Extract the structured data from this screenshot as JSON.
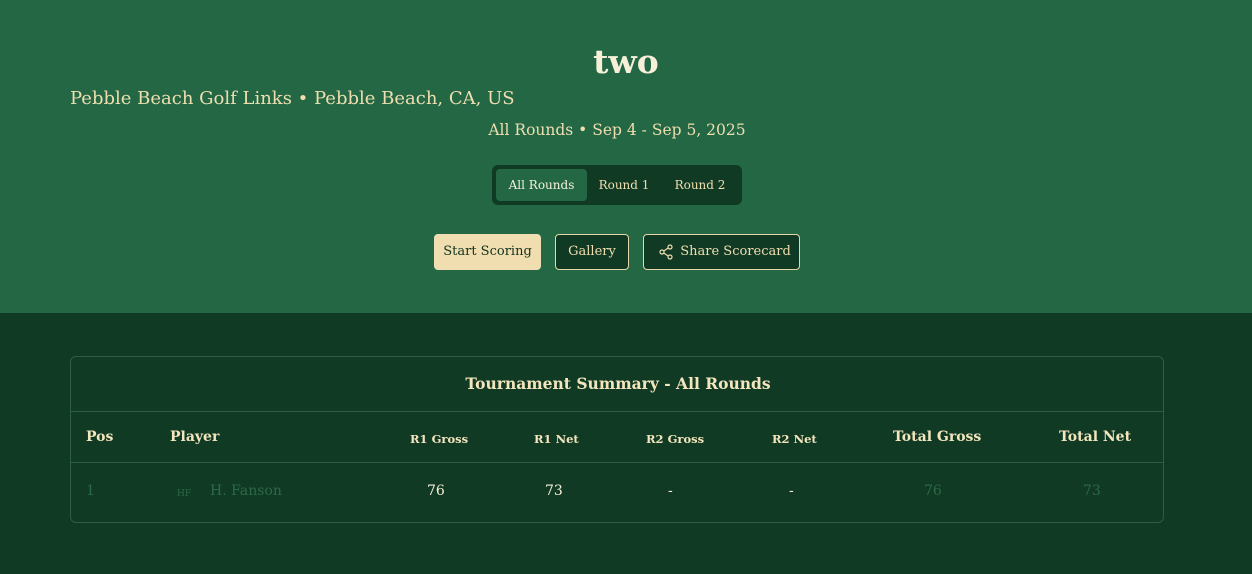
{
  "header": {
    "title": "two",
    "course": "Pebble Beach Golf Links • Pebble Beach, CA, US",
    "dates": "All Rounds • Sep 4 - Sep 5, 2025"
  },
  "tabs": [
    {
      "label": "All Rounds",
      "active": true
    },
    {
      "label": "Round 1",
      "active": false
    },
    {
      "label": "Round 2",
      "active": false
    }
  ],
  "actions": {
    "start_scoring": "Start Scoring",
    "gallery": "Gallery",
    "share_scorecard": "Share Scorecard",
    "share_icon": "share-icon"
  },
  "summary": {
    "title": "Tournament Summary - All Rounds",
    "columns": [
      "Pos",
      "Player",
      "R1 Gross",
      "R1 Net",
      "R2 Gross",
      "R2 Net",
      "Total Gross",
      "Total Net"
    ],
    "rows": [
      {
        "pos": "1",
        "initials": "HF",
        "player": "H. Fanson",
        "r1_gross": "76",
        "r1_net": "73",
        "r2_gross": "-",
        "r2_net": "-",
        "total_gross": "76",
        "total_net": "73"
      }
    ]
  },
  "colors": {
    "hero_bg": "#236745",
    "page_bg": "#113a25",
    "accent": "#f0deb0",
    "muted_text": "#2b6a48"
  }
}
